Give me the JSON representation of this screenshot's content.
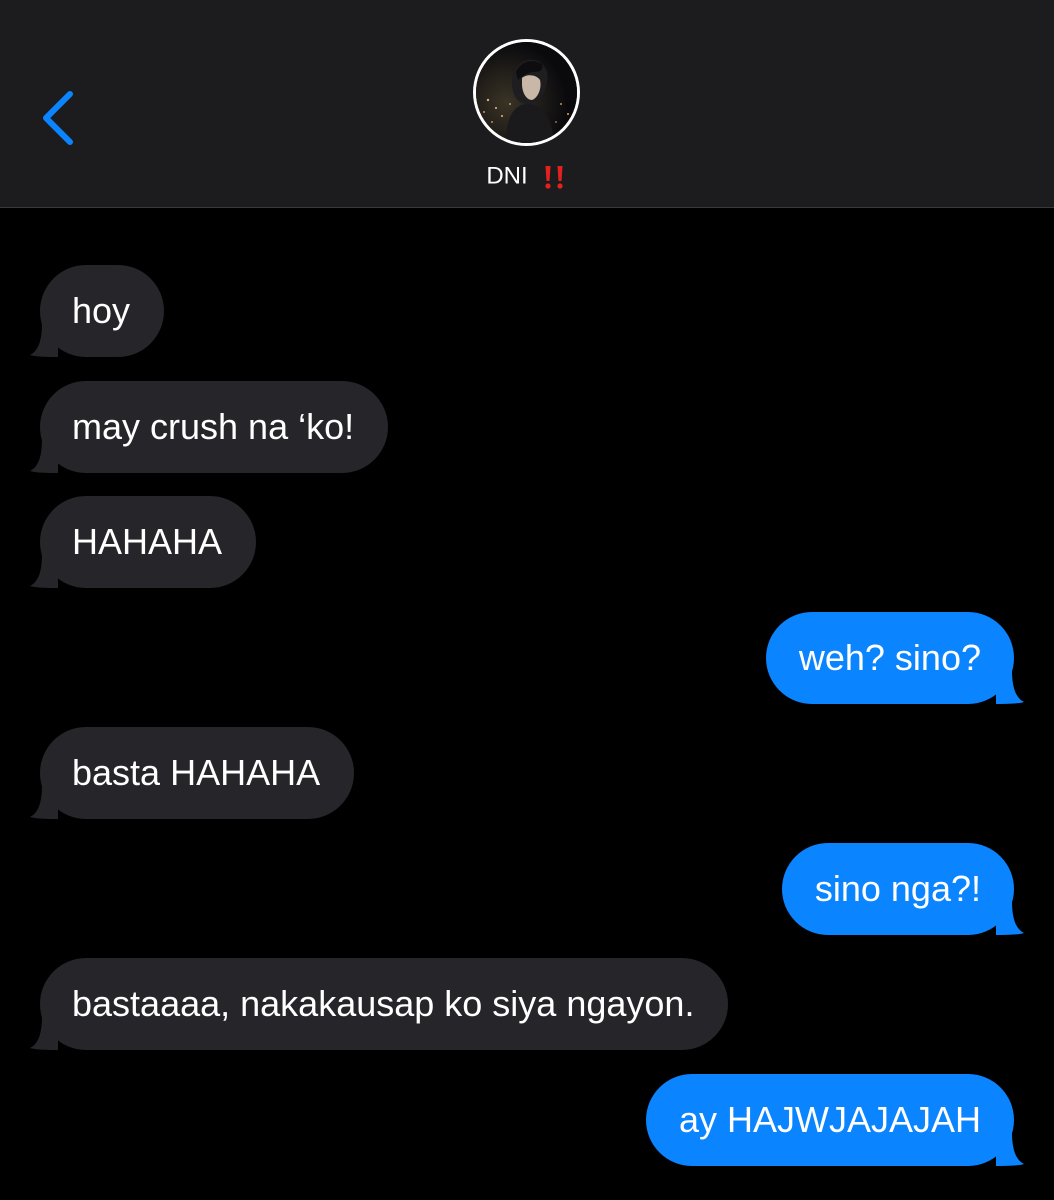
{
  "header": {
    "contact_name": "DNI",
    "contact_emoji": "‼️",
    "back_icon": "chevron-left-icon",
    "avatar": "contact-avatar-photo",
    "accent_color": "#0b84ff"
  },
  "messages": [
    {
      "direction": "received",
      "text": "hoy"
    },
    {
      "direction": "received",
      "text": "may crush na ‘ko!"
    },
    {
      "direction": "received",
      "text": "HAHAHA"
    },
    {
      "direction": "sent",
      "text": "weh? sino?"
    },
    {
      "direction": "received",
      "text": "basta HAHAHA"
    },
    {
      "direction": "sent",
      "text": "sino nga?!"
    },
    {
      "direction": "received",
      "text": "bastaaaa, nakakausap ko siya ngayon."
    },
    {
      "direction": "sent",
      "text": "ay HAJWJAJAJAH"
    }
  ],
  "colors": {
    "received_bubble": "#26252a",
    "sent_bubble": "#0b84ff",
    "header_bg": "#1c1c1e",
    "background": "#000000"
  }
}
